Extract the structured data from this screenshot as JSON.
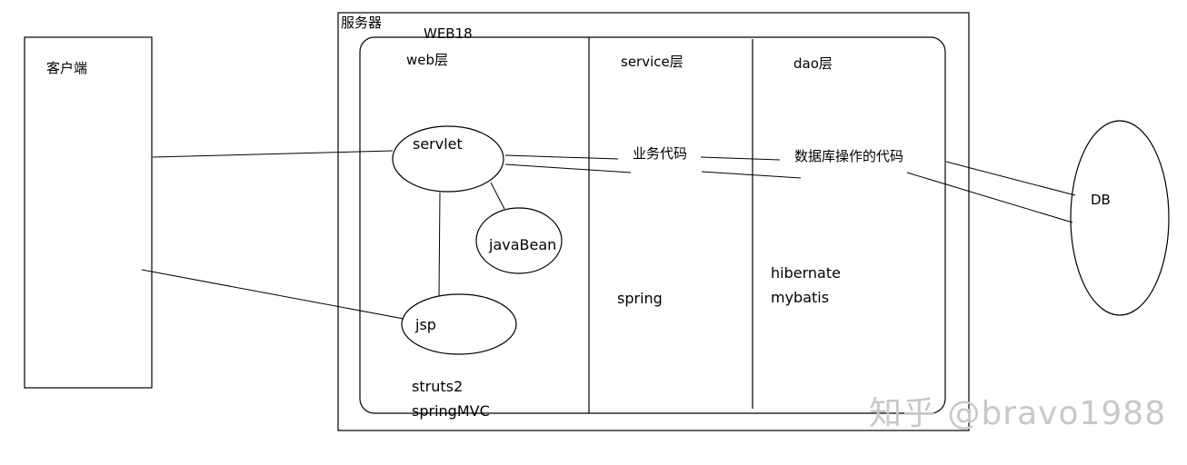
{
  "client": {
    "label": "客户端"
  },
  "server": {
    "label": "服务器",
    "app_name": "WEB18"
  },
  "layers": {
    "web": {
      "title": "web层",
      "frameworks": [
        "struts2",
        "springMVC"
      ]
    },
    "service": {
      "title": "service层",
      "content": "业务代码",
      "frameworks": [
        "spring"
      ]
    },
    "dao": {
      "title": "dao层",
      "content": "数据库操作的代码",
      "frameworks": [
        "hibernate",
        "mybatis"
      ]
    }
  },
  "components": {
    "servlet": "servlet",
    "javabean": "javaBean",
    "jsp": "jsp"
  },
  "database": {
    "label": "DB"
  },
  "watermark": "知乎 @bravo1988"
}
